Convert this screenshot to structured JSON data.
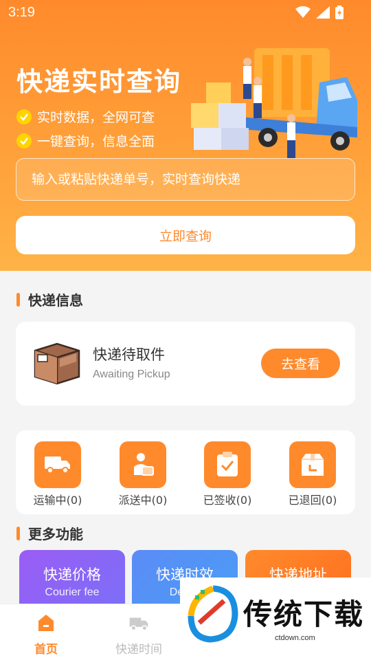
{
  "status_bar": {
    "time": "3:19"
  },
  "hero": {
    "title": "快递实时查询",
    "features": [
      "实时数据，全网可查",
      "一键查询，信息全面"
    ],
    "search_placeholder": "输入或粘贴快递单号，实时查询快递",
    "query_button": "立即查询"
  },
  "express_info": {
    "title": "快递信息",
    "pickup": {
      "title": "快递待取件",
      "subtitle": "Awaiting Pickup",
      "button": "去查看"
    },
    "statuses": [
      {
        "label": "运输中(0)",
        "icon": "truck-icon"
      },
      {
        "label": "派送中(0)",
        "icon": "courier-icon"
      },
      {
        "label": "已签收(0)",
        "icon": "clipboard-check-icon"
      },
      {
        "label": "已退回(0)",
        "icon": "return-box-icon"
      }
    ]
  },
  "more_functions": {
    "title": "更多功能",
    "tiles": [
      {
        "title": "快递价格",
        "subtitle": "Courier fee",
        "color": "#9b5cf6"
      },
      {
        "title": "快递时效",
        "subtitle": "Delive",
        "color": "#5b8cf7"
      },
      {
        "title": "快递地址",
        "subtitle": "",
        "color": "#ff8a2c"
      }
    ]
  },
  "tabbar": {
    "tabs": [
      {
        "label": "首页",
        "active": true
      },
      {
        "label": "快递时间",
        "active": false
      }
    ]
  },
  "watermark": {
    "text": "传统下载",
    "url": "ctdown.com"
  },
  "colors": {
    "accent": "#ff8a2c",
    "check": "#ffd400"
  }
}
